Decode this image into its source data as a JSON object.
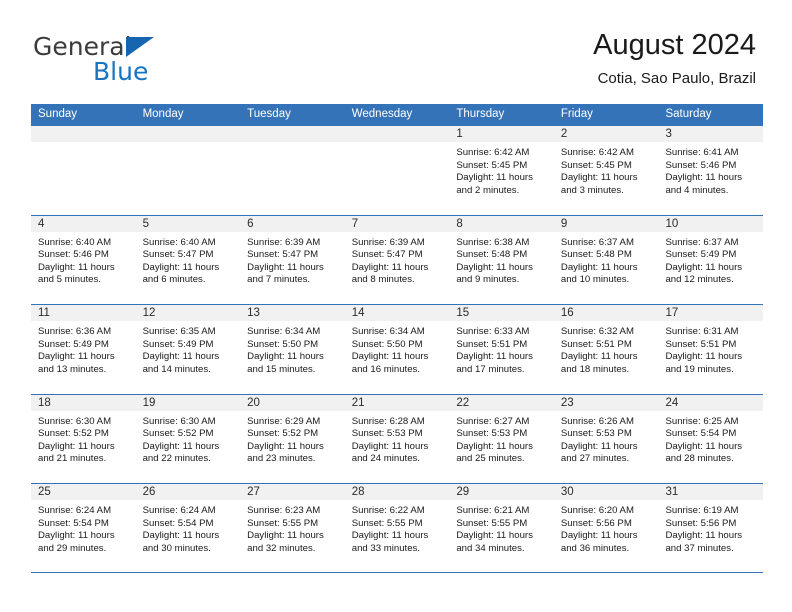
{
  "brand": {
    "name_part1": "General",
    "name_part2": "Blue",
    "accent_color": "#1574c4",
    "triangle_color": "#1565b0"
  },
  "header": {
    "title": "August 2024",
    "subtitle": "Cotia, Sao Paulo, Brazil"
  },
  "theme": {
    "header_blue": "#3573b9",
    "daynum_band": "#f1f1f1"
  },
  "weekdays": [
    "Sunday",
    "Monday",
    "Tuesday",
    "Wednesday",
    "Thursday",
    "Friday",
    "Saturday"
  ],
  "weeks": [
    [
      {
        "day": "",
        "sunrise": "",
        "sunset": "",
        "daylight_line1": "",
        "daylight_line2": ""
      },
      {
        "day": "",
        "sunrise": "",
        "sunset": "",
        "daylight_line1": "",
        "daylight_line2": ""
      },
      {
        "day": "",
        "sunrise": "",
        "sunset": "",
        "daylight_line1": "",
        "daylight_line2": ""
      },
      {
        "day": "",
        "sunrise": "",
        "sunset": "",
        "daylight_line1": "",
        "daylight_line2": ""
      },
      {
        "day": "1",
        "sunrise": "Sunrise: 6:42 AM",
        "sunset": "Sunset: 5:45 PM",
        "daylight_line1": "Daylight: 11 hours",
        "daylight_line2": "and 2 minutes."
      },
      {
        "day": "2",
        "sunrise": "Sunrise: 6:42 AM",
        "sunset": "Sunset: 5:45 PM",
        "daylight_line1": "Daylight: 11 hours",
        "daylight_line2": "and 3 minutes."
      },
      {
        "day": "3",
        "sunrise": "Sunrise: 6:41 AM",
        "sunset": "Sunset: 5:46 PM",
        "daylight_line1": "Daylight: 11 hours",
        "daylight_line2": "and 4 minutes."
      }
    ],
    [
      {
        "day": "4",
        "sunrise": "Sunrise: 6:40 AM",
        "sunset": "Sunset: 5:46 PM",
        "daylight_line1": "Daylight: 11 hours",
        "daylight_line2": "and 5 minutes."
      },
      {
        "day": "5",
        "sunrise": "Sunrise: 6:40 AM",
        "sunset": "Sunset: 5:47 PM",
        "daylight_line1": "Daylight: 11 hours",
        "daylight_line2": "and 6 minutes."
      },
      {
        "day": "6",
        "sunrise": "Sunrise: 6:39 AM",
        "sunset": "Sunset: 5:47 PM",
        "daylight_line1": "Daylight: 11 hours",
        "daylight_line2": "and 7 minutes."
      },
      {
        "day": "7",
        "sunrise": "Sunrise: 6:39 AM",
        "sunset": "Sunset: 5:47 PM",
        "daylight_line1": "Daylight: 11 hours",
        "daylight_line2": "and 8 minutes."
      },
      {
        "day": "8",
        "sunrise": "Sunrise: 6:38 AM",
        "sunset": "Sunset: 5:48 PM",
        "daylight_line1": "Daylight: 11 hours",
        "daylight_line2": "and 9 minutes."
      },
      {
        "day": "9",
        "sunrise": "Sunrise: 6:37 AM",
        "sunset": "Sunset: 5:48 PM",
        "daylight_line1": "Daylight: 11 hours",
        "daylight_line2": "and 10 minutes."
      },
      {
        "day": "10",
        "sunrise": "Sunrise: 6:37 AM",
        "sunset": "Sunset: 5:49 PM",
        "daylight_line1": "Daylight: 11 hours",
        "daylight_line2": "and 12 minutes."
      }
    ],
    [
      {
        "day": "11",
        "sunrise": "Sunrise: 6:36 AM",
        "sunset": "Sunset: 5:49 PM",
        "daylight_line1": "Daylight: 11 hours",
        "daylight_line2": "and 13 minutes."
      },
      {
        "day": "12",
        "sunrise": "Sunrise: 6:35 AM",
        "sunset": "Sunset: 5:49 PM",
        "daylight_line1": "Daylight: 11 hours",
        "daylight_line2": "and 14 minutes."
      },
      {
        "day": "13",
        "sunrise": "Sunrise: 6:34 AM",
        "sunset": "Sunset: 5:50 PM",
        "daylight_line1": "Daylight: 11 hours",
        "daylight_line2": "and 15 minutes."
      },
      {
        "day": "14",
        "sunrise": "Sunrise: 6:34 AM",
        "sunset": "Sunset: 5:50 PM",
        "daylight_line1": "Daylight: 11 hours",
        "daylight_line2": "and 16 minutes."
      },
      {
        "day": "15",
        "sunrise": "Sunrise: 6:33 AM",
        "sunset": "Sunset: 5:51 PM",
        "daylight_line1": "Daylight: 11 hours",
        "daylight_line2": "and 17 minutes."
      },
      {
        "day": "16",
        "sunrise": "Sunrise: 6:32 AM",
        "sunset": "Sunset: 5:51 PM",
        "daylight_line1": "Daylight: 11 hours",
        "daylight_line2": "and 18 minutes."
      },
      {
        "day": "17",
        "sunrise": "Sunrise: 6:31 AM",
        "sunset": "Sunset: 5:51 PM",
        "daylight_line1": "Daylight: 11 hours",
        "daylight_line2": "and 19 minutes."
      }
    ],
    [
      {
        "day": "18",
        "sunrise": "Sunrise: 6:30 AM",
        "sunset": "Sunset: 5:52 PM",
        "daylight_line1": "Daylight: 11 hours",
        "daylight_line2": "and 21 minutes."
      },
      {
        "day": "19",
        "sunrise": "Sunrise: 6:30 AM",
        "sunset": "Sunset: 5:52 PM",
        "daylight_line1": "Daylight: 11 hours",
        "daylight_line2": "and 22 minutes."
      },
      {
        "day": "20",
        "sunrise": "Sunrise: 6:29 AM",
        "sunset": "Sunset: 5:52 PM",
        "daylight_line1": "Daylight: 11 hours",
        "daylight_line2": "and 23 minutes."
      },
      {
        "day": "21",
        "sunrise": "Sunrise: 6:28 AM",
        "sunset": "Sunset: 5:53 PM",
        "daylight_line1": "Daylight: 11 hours",
        "daylight_line2": "and 24 minutes."
      },
      {
        "day": "22",
        "sunrise": "Sunrise: 6:27 AM",
        "sunset": "Sunset: 5:53 PM",
        "daylight_line1": "Daylight: 11 hours",
        "daylight_line2": "and 25 minutes."
      },
      {
        "day": "23",
        "sunrise": "Sunrise: 6:26 AM",
        "sunset": "Sunset: 5:53 PM",
        "daylight_line1": "Daylight: 11 hours",
        "daylight_line2": "and 27 minutes."
      },
      {
        "day": "24",
        "sunrise": "Sunrise: 6:25 AM",
        "sunset": "Sunset: 5:54 PM",
        "daylight_line1": "Daylight: 11 hours",
        "daylight_line2": "and 28 minutes."
      }
    ],
    [
      {
        "day": "25",
        "sunrise": "Sunrise: 6:24 AM",
        "sunset": "Sunset: 5:54 PM",
        "daylight_line1": "Daylight: 11 hours",
        "daylight_line2": "and 29 minutes."
      },
      {
        "day": "26",
        "sunrise": "Sunrise: 6:24 AM",
        "sunset": "Sunset: 5:54 PM",
        "daylight_line1": "Daylight: 11 hours",
        "daylight_line2": "and 30 minutes."
      },
      {
        "day": "27",
        "sunrise": "Sunrise: 6:23 AM",
        "sunset": "Sunset: 5:55 PM",
        "daylight_line1": "Daylight: 11 hours",
        "daylight_line2": "and 32 minutes."
      },
      {
        "day": "28",
        "sunrise": "Sunrise: 6:22 AM",
        "sunset": "Sunset: 5:55 PM",
        "daylight_line1": "Daylight: 11 hours",
        "daylight_line2": "and 33 minutes."
      },
      {
        "day": "29",
        "sunrise": "Sunrise: 6:21 AM",
        "sunset": "Sunset: 5:55 PM",
        "daylight_line1": "Daylight: 11 hours",
        "daylight_line2": "and 34 minutes."
      },
      {
        "day": "30",
        "sunrise": "Sunrise: 6:20 AM",
        "sunset": "Sunset: 5:56 PM",
        "daylight_line1": "Daylight: 11 hours",
        "daylight_line2": "and 36 minutes."
      },
      {
        "day": "31",
        "sunrise": "Sunrise: 6:19 AM",
        "sunset": "Sunset: 5:56 PM",
        "daylight_line1": "Daylight: 11 hours",
        "daylight_line2": "and 37 minutes."
      }
    ]
  ]
}
